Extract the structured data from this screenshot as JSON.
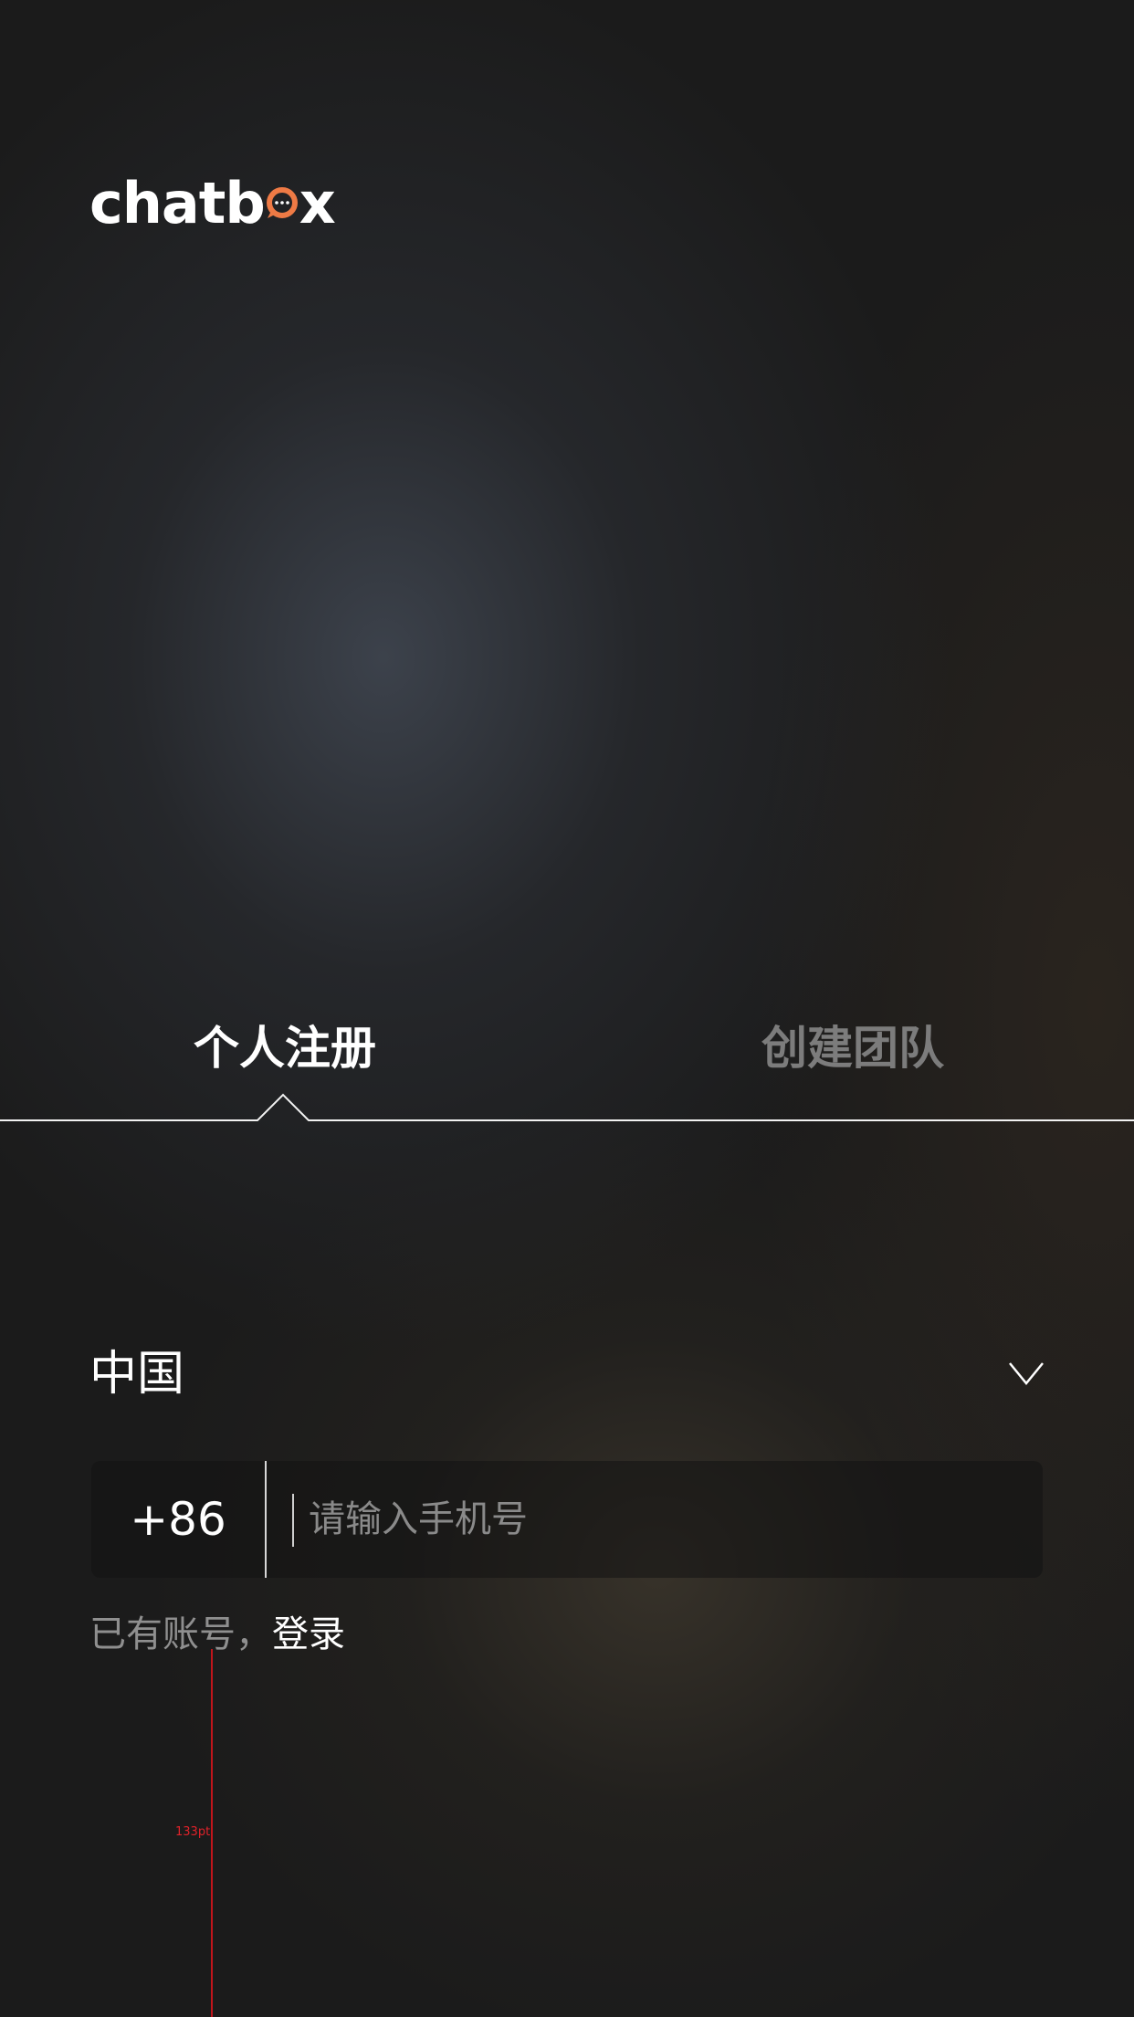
{
  "brand": {
    "logo_prefix": "chatb",
    "logo_suffix": "x",
    "logo_accent_color": "#EE7A45"
  },
  "tabs": [
    {
      "label": "个人注册",
      "active": true
    },
    {
      "label": "创建团队",
      "active": false
    }
  ],
  "country_select": {
    "value": "中国",
    "icon": "chevron-down-icon"
  },
  "phone": {
    "country_code": "+86",
    "placeholder": "请输入手机号",
    "value": ""
  },
  "login_hint": {
    "text": "已有账号，",
    "link_label": "登录"
  },
  "annotation": {
    "label": "133pt",
    "color": "#C0151B"
  }
}
